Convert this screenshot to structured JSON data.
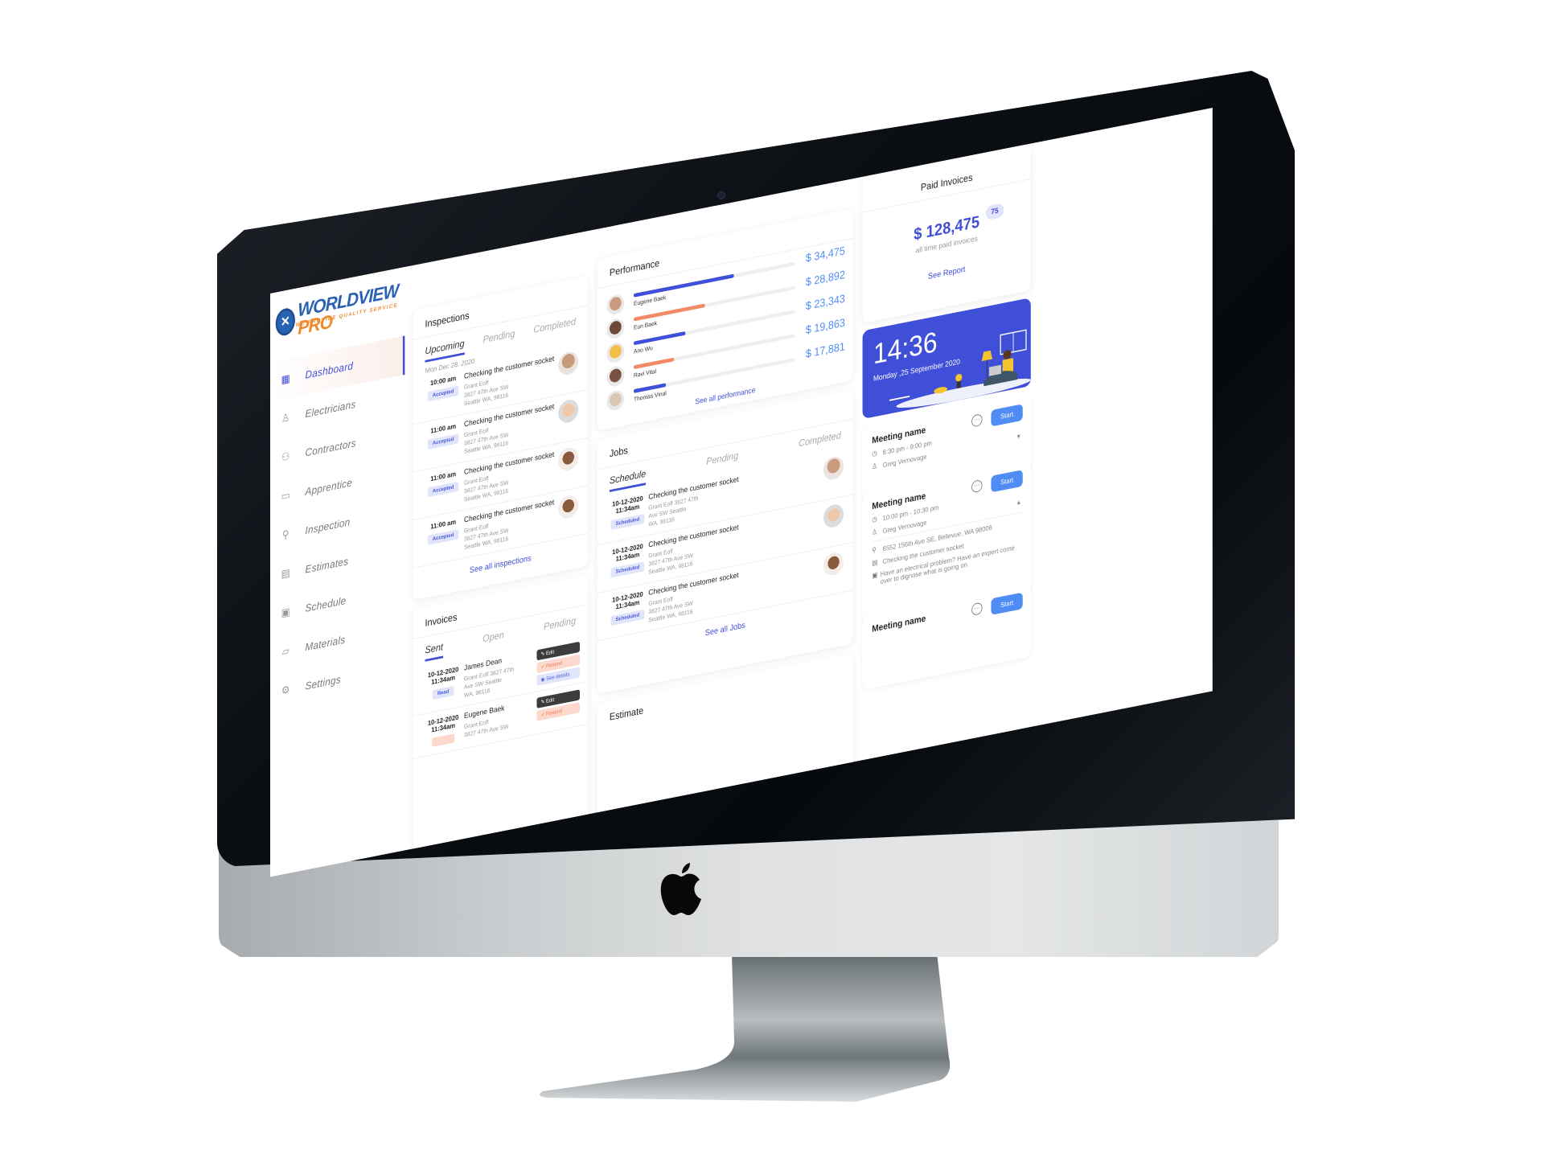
{
  "device": {
    "type": "iMac mockup",
    "brand_icon": "apple-logo-icon"
  },
  "brand": {
    "name_part1": "WORLDVIEW",
    "name_part2": "PRO",
    "tagline": "WE PROVIDE QUALITY SERVICE",
    "colors": {
      "blue": "#2a62b3",
      "orange": "#f0892a"
    }
  },
  "theme": {
    "accent": "#3f4fd8",
    "accent_light": "#e1e5fb",
    "salmon": "#f28a66",
    "value_blue": "#4f8df5"
  },
  "sidebar": {
    "items": [
      {
        "label": "Dashboard",
        "icon": "dashboard-grid-icon",
        "active": true
      },
      {
        "label": "Electricians",
        "icon": "electrician-icon",
        "active": false
      },
      {
        "label": "Contractors",
        "icon": "contractors-icon",
        "active": false
      },
      {
        "label": "Apprentice",
        "icon": "apprentice-card-icon",
        "active": false
      },
      {
        "label": "Inspection",
        "icon": "magnifier-icon",
        "active": false
      },
      {
        "label": "Estimates",
        "icon": "estimates-document-icon",
        "active": false
      },
      {
        "label": "Schedule",
        "icon": "calendar-clock-icon",
        "active": false
      },
      {
        "label": "Materials",
        "icon": "materials-folder-icon",
        "active": false
      },
      {
        "label": "Settings",
        "icon": "gear-icon",
        "active": false
      }
    ]
  },
  "inspections": {
    "title": "Inspections",
    "tabs": [
      "Upcoming",
      "Pending",
      "Completed"
    ],
    "active_tab": "Upcoming",
    "date_label": "Mon Dec 28, 2020",
    "items": [
      {
        "time": "10:00 am",
        "status": "Accepted",
        "title": "Checking the customer socket",
        "name": "Grant Eoff",
        "address1": "3827 47th Ave SW",
        "address2": "Seattle WA, 98116"
      },
      {
        "time": "11:00 am",
        "status": "Accepted",
        "title": "Checking the customer socket",
        "name": "Grant Eoff",
        "address1": "3827 47th Ave SW",
        "address2": "Seattle WA, 98116"
      },
      {
        "time": "11:00 am",
        "status": "Accepted",
        "title": "Checking the customer socket",
        "name": "Grant Eoff",
        "address1": "3827 47th Ave SW",
        "address2": "Seattle WA, 98116"
      },
      {
        "time": "11:00 am",
        "status": "Accepted",
        "title": "Checking the customer socket",
        "name": "Grant Eoff",
        "address1": "3827 47th Ave SW",
        "address2": "Seattle WA, 98116"
      }
    ],
    "see_all": "See all inspections"
  },
  "invoices": {
    "title": "Invoices",
    "tabs": [
      "Sent",
      "Open",
      "Pending"
    ],
    "active_tab": "Sent",
    "items": [
      {
        "date": "10-12-2020",
        "time": "11:34am",
        "status": "Read",
        "name": "James Dean",
        "address1": "Grant Eoff 3827 47th",
        "address2": "Ave SW Seattle",
        "address3": "WA, 98116"
      },
      {
        "date": "10-12-2020",
        "time": "11:34am",
        "status": "",
        "name": "Eugene Baek",
        "address1": "Grant Eoff",
        "address2": "3827 47th Ave SW",
        "address3": ""
      }
    ],
    "actions": {
      "edit": "Edit",
      "resend": "Resend",
      "details": "See details"
    }
  },
  "performance": {
    "title": "Performance",
    "rows": [
      {
        "name": "Eugene Baek",
        "value": "$ 34,475",
        "progress": 0.62,
        "color": "#3f4fd8"
      },
      {
        "name": "Eun Baek",
        "value": "$ 28,892",
        "progress": 0.44,
        "color": "#f28a66"
      },
      {
        "name": "Ano Wu",
        "value": "$ 23,343",
        "progress": 0.32,
        "color": "#3f4fd8"
      },
      {
        "name": "Ravi Vital",
        "value": "$ 19,863",
        "progress": 0.25,
        "color": "#f28a66"
      },
      {
        "name": "Thomas Vinal",
        "value": "$ 17,881",
        "progress": 0.2,
        "color": "#3f4fd8"
      }
    ],
    "see_all": "See all performance"
  },
  "jobs": {
    "title": "Jobs",
    "tabs": [
      "Schedule",
      "Pending",
      "Completed"
    ],
    "active_tab": "Schedule",
    "items": [
      {
        "date": "10-12-2020",
        "time": "11:34am",
        "status": "Scheduled",
        "title": "Checking the customer socket",
        "address1": "Grant Eoff 3827 47th",
        "address2": "Ave SW Seattle",
        "address3": "WA, 98116"
      },
      {
        "date": "10-12-2020",
        "time": "11:34am",
        "status": "Scheduled",
        "title": "Checking the customer socket",
        "address1": "Grant Eoff",
        "address2": "3827 47th Ave SW",
        "address3": "Seattle WA, 98116"
      },
      {
        "date": "10-12-2020",
        "time": "11:34am",
        "status": "Scheduled",
        "title": "Checking the customer socket",
        "address1": "Grant Eoff",
        "address2": "3827 47th Ave SW",
        "address3": "Seattle WA, 98116"
      }
    ],
    "see_all": "See all Jobs"
  },
  "estimate": {
    "title": "Estimate"
  },
  "paid_invoices": {
    "title": "Paid Invoices",
    "count": "75",
    "amount": "$ 128,475",
    "subtitle": "all time paid invoices",
    "link": "See Report"
  },
  "clock": {
    "time": "14:36",
    "date": "Monday ,25 September 2020"
  },
  "meetings": [
    {
      "name": "Meeting name",
      "time": "8:30 pm - 9:00 pm",
      "person": "Greg Vernovage",
      "start": "Start",
      "expanded": false
    },
    {
      "name": "Meeting name",
      "time": "10:00 pm - 10:30 pm",
      "person": "Greg Vernovage",
      "start": "Start",
      "expanded": true,
      "address": "6552 156th Ave SE, Bellevue, WA 98006",
      "task": "Checking the customer socket",
      "description": "Have an electrical problem? Have an expert come over to dignose what is going on"
    },
    {
      "name": "Meeting name",
      "start": "Start"
    }
  ]
}
